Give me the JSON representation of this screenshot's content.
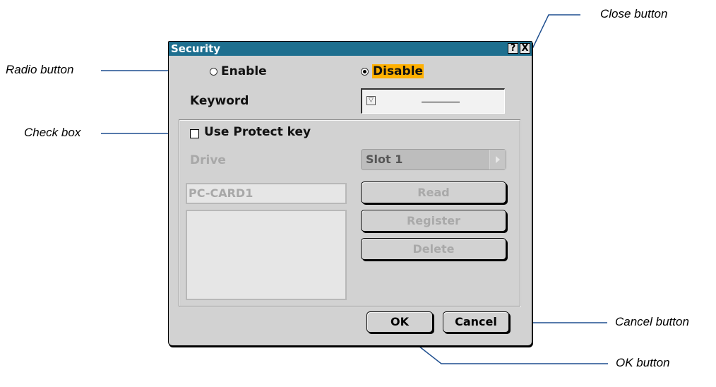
{
  "annotations": {
    "close": "Close button",
    "radio": "Radio button",
    "check": "Check box",
    "cancel": "Cancel button",
    "ok": "OK button"
  },
  "dialog": {
    "title": "Security",
    "help_glyph": "?",
    "close_glyph": "X",
    "enable_label": "Enable",
    "disable_label": "Disable",
    "selected": "Disable",
    "keyword_label": "Keyword",
    "protect_label": "Use Protect key",
    "drive_label": "Drive",
    "slot_value": "Slot 1",
    "card_name": "PC-CARD1",
    "read_label": "Read",
    "register_label": "Register",
    "delete_label": "Delete",
    "ok_label": "OK",
    "cancel_label": "Cancel"
  },
  "colors": {
    "titlebar": "#1e6f8f",
    "highlight": "#ffb000",
    "callout_line": "#1f4f8f"
  }
}
